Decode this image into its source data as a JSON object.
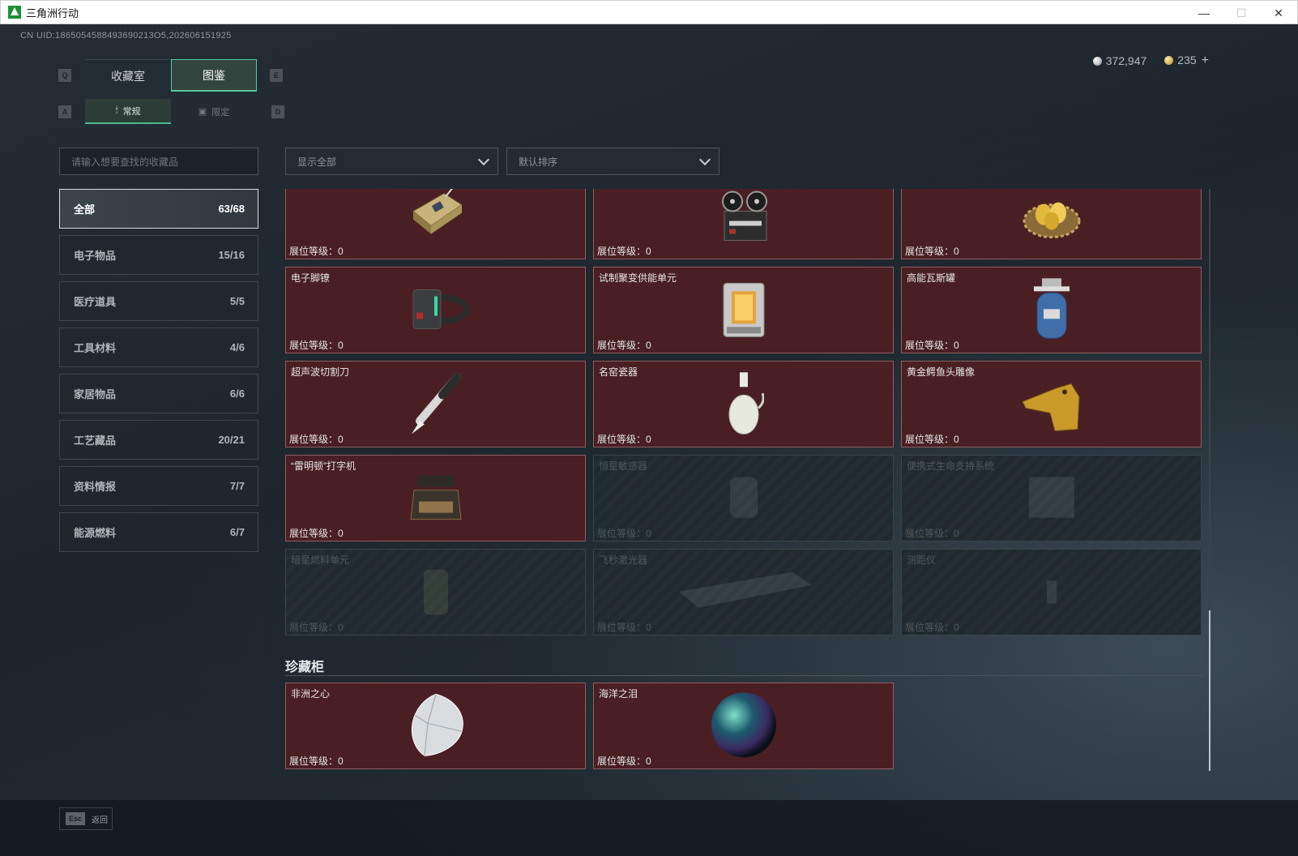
{
  "window": {
    "title": "三角洲行动",
    "minimize": "—",
    "maximize": "☐",
    "close": "✕"
  },
  "uid": "CN UID:1865054588493690213O5,202606151925",
  "currency": {
    "silver": "372,947",
    "gold": "235",
    "plus": "+"
  },
  "keys": {
    "tab_left": "Q",
    "tab_right": "E",
    "sub_left": "A",
    "sub_right": "D",
    "esc": "Esc"
  },
  "tabs": [
    {
      "label": "收藏室"
    },
    {
      "label": "图鉴"
    }
  ],
  "subtabs": [
    {
      "label": "常规",
      "icon": "🕯"
    },
    {
      "label": "限定",
      "icon": "▣"
    }
  ],
  "search": {
    "placeholder": "请输入想要查找的收藏品"
  },
  "filter": {
    "value": "显示全部"
  },
  "sort": {
    "value": "默认排序"
  },
  "categories": [
    {
      "label": "全部",
      "count": "63/68"
    },
    {
      "label": "电子物品",
      "count": "15/16"
    },
    {
      "label": "医疗道具",
      "count": "5/5"
    },
    {
      "label": "工具材料",
      "count": "4/6"
    },
    {
      "label": "家居物品",
      "count": "6/6"
    },
    {
      "label": "工艺藏品",
      "count": "20/21"
    },
    {
      "label": "资料情报",
      "count": "7/7"
    },
    {
      "label": "能源燃料",
      "count": "6/7"
    }
  ],
  "level_label": "展位等级：0",
  "items": [
    {
      "name": "",
      "icon": "router-icon"
    },
    {
      "name": "",
      "icon": "tape-recorder-icon"
    },
    {
      "name": "",
      "icon": "golden-eggs-nest-icon"
    },
    {
      "name": "电子脚镣",
      "icon": "ankle-monitor-icon"
    },
    {
      "name": "试制聚变供能单元",
      "icon": "fusion-cell-icon"
    },
    {
      "name": "高能瓦斯罐",
      "icon": "gas-canister-icon"
    },
    {
      "name": "超声波切割刀",
      "icon": "ultrasonic-knife-icon"
    },
    {
      "name": "名窑瓷器",
      "icon": "porcelain-vase-icon"
    },
    {
      "name": "黄金鳄鱼头雕像",
      "icon": "gold-crocodile-icon"
    },
    {
      "name": "“雷明顿”打字机",
      "icon": "typewriter-icon"
    },
    {
      "name": "恒星敏感器",
      "icon": "star-sensor-icon",
      "locked": true
    },
    {
      "name": "便携式生命支持系统",
      "icon": "life-support-icon",
      "locked": true
    },
    {
      "name": "暗星燃料单元",
      "icon": "fuel-cell-icon",
      "locked": true
    },
    {
      "name": "飞秒激光器",
      "icon": "laser-icon",
      "locked": true
    },
    {
      "name": "测距仪",
      "icon": "rangefinder-icon",
      "locked": true
    }
  ],
  "treasure": {
    "title": "珍藏柜",
    "items": [
      {
        "name": "非洲之心",
        "icon": "diamond-icon"
      },
      {
        "name": "海洋之泪",
        "icon": "pearl-icon"
      }
    ]
  },
  "footer": {
    "back_label": "返回"
  }
}
